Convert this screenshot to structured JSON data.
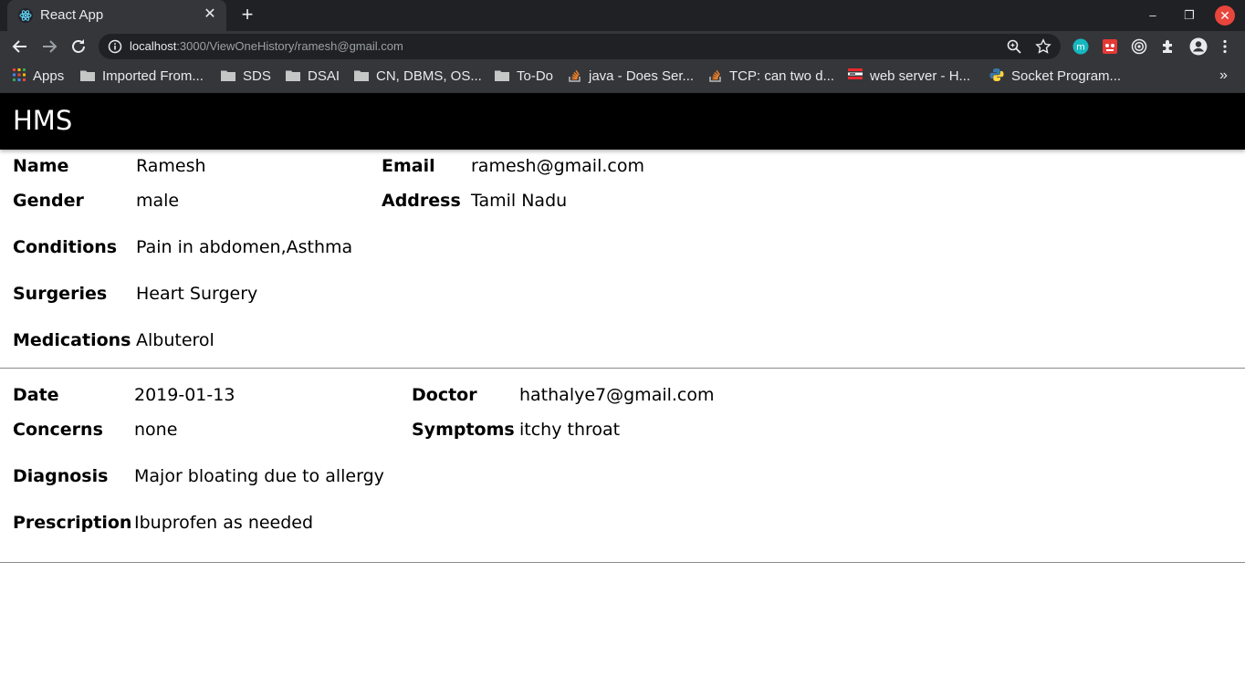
{
  "browser": {
    "tab_title": "React App",
    "url_host": "localhost",
    "url_rest": ":3000/ViewOneHistory/ramesh@gmail.com",
    "bookmarks": [
      {
        "label": "Apps",
        "icon": "apps-grid-icon"
      },
      {
        "label": "Imported From...",
        "icon": "folder-icon"
      },
      {
        "label": "SDS",
        "icon": "folder-icon"
      },
      {
        "label": "DSAI",
        "icon": "folder-icon"
      },
      {
        "label": "CN, DBMS, OS...",
        "icon": "folder-icon"
      },
      {
        "label": "To-Do",
        "icon": "folder-icon"
      },
      {
        "label": "java - Does Ser...",
        "icon": "stackoverflow-icon"
      },
      {
        "label": "TCP: can two d...",
        "icon": "stackoverflow-icon"
      },
      {
        "label": "web server - H...",
        "icon": "serverfault-icon"
      },
      {
        "label": "Socket Program...",
        "icon": "python-icon"
      }
    ]
  },
  "app": {
    "title": "HMS"
  },
  "patient": {
    "name_label": "Name",
    "name": "Ramesh",
    "email_label": "Email",
    "email": "ramesh@gmail.com",
    "gender_label": "Gender",
    "gender": "male",
    "address_label": "Address",
    "address": "Tamil Nadu",
    "conditions_label": "Conditions",
    "conditions": "Pain in abdomen,Asthma",
    "surgeries_label": "Surgeries",
    "surgeries": "Heart Surgery",
    "medications_label": "Medications",
    "medications": "Albuterol"
  },
  "appointment": {
    "date_label": "Date",
    "date": "2019-01-13",
    "doctor_label": "Doctor",
    "doctor": "hathalye7@gmail.com",
    "concerns_label": "Concerns",
    "concerns": "none",
    "symptoms_label": "Symptoms",
    "symptoms": "itchy throat",
    "diagnosis_label": "Diagnosis",
    "diagnosis": "Major bloating due to allergy",
    "prescription_label": "Prescription",
    "prescription": "Ibuprofen as needed"
  }
}
